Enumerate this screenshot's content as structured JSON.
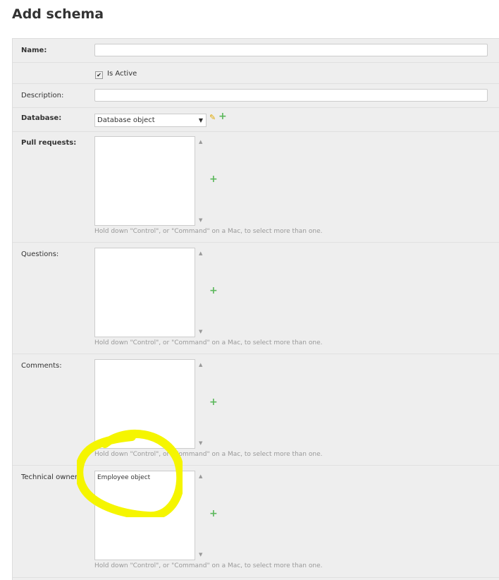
{
  "page": {
    "title": "Add schema"
  },
  "fields": {
    "name": {
      "label": "Name:",
      "value": ""
    },
    "is_active": {
      "label": "Is Active",
      "checked": true
    },
    "description": {
      "label": "Description:",
      "value": ""
    },
    "database": {
      "label": "Database:",
      "selected": "Database object"
    },
    "pull_requests": {
      "label": "Pull requests:",
      "options": []
    },
    "questions": {
      "label": "Questions:",
      "options": []
    },
    "comments": {
      "label": "Comments:",
      "options": []
    },
    "technical_owners": {
      "label": "Technical owners:",
      "options": [
        "Employee object"
      ]
    }
  },
  "help_text": "Hold down \"Control\", or \"Command\" on a Mac, to select more than one.",
  "icons": {
    "edit": "pencil-icon",
    "add": "plus-icon",
    "check": "checkmark-icon"
  },
  "colors": {
    "add_icon": "#5cb85c",
    "edit_icon": "#e0a800",
    "highlight": "#f5f500"
  }
}
